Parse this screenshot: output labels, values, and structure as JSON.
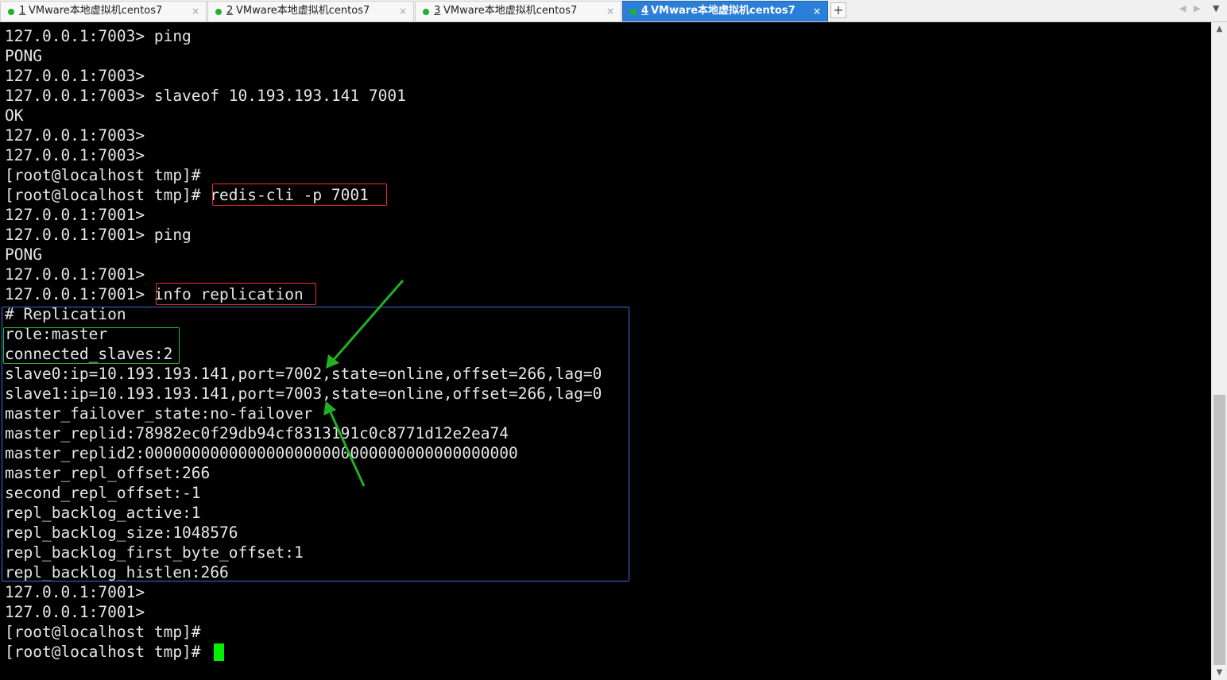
{
  "tabs": [
    {
      "number": "1",
      "label": "VMware本地虚拟机centos7",
      "status_color": "#1db32b",
      "active": false
    },
    {
      "number": "2",
      "label": "VMware本地虚拟机centos7",
      "status_color": "#1db32b",
      "active": false
    },
    {
      "number": "3",
      "label": "VMware本地虚拟机centos7",
      "status_color": "#1db32b",
      "active": false
    },
    {
      "number": "4",
      "label": "VMware本地虚拟机centos7",
      "status_color": "#1db32b",
      "active": true
    }
  ],
  "tab_close_glyph": "×",
  "add_tab_glyph": "+",
  "tab_prev_glyph": "◀",
  "tab_next_glyph": "▶",
  "terminal": {
    "lines": [
      "127.0.0.1:7003> ping",
      "PONG",
      "127.0.0.1:7003>",
      "127.0.0.1:7003> slaveof 10.193.193.141 7001",
      "OK",
      "127.0.0.1:7003>",
      "127.0.0.1:7003>",
      "[root@localhost tmp]#",
      "[root@localhost tmp]# redis-cli -p 7001",
      "127.0.0.1:7001>",
      "127.0.0.1:7001> ping",
      "PONG",
      "127.0.0.1:7001>",
      "127.0.0.1:7001> info replication",
      "# Replication",
      "role:master",
      "connected_slaves:2",
      "slave0:ip=10.193.193.141,port=7002,state=online,offset=266,lag=0",
      "slave1:ip=10.193.193.141,port=7003,state=online,offset=266,lag=0",
      "master_failover_state:no-failover",
      "master_replid:78982ec0f29db94cf8313191c0c8771d12e2ea74",
      "master_replid2:0000000000000000000000000000000000000000",
      "master_repl_offset:266",
      "second_repl_offset:-1",
      "repl_backlog_active:1",
      "repl_backlog_size:1048576",
      "repl_backlog_first_byte_offset:1",
      "repl_backlog_histlen:266",
      "127.0.0.1:7001>",
      "127.0.0.1:7001>",
      "[root@localhost tmp]#",
      "[root@localhost tmp]#"
    ],
    "text_color": "#e6e6e6",
    "background": "#000000",
    "cursor_color": "#00f000"
  },
  "annotations": {
    "red_box_color": "#ea2f2f",
    "blue_box_color": "#3b6fd6",
    "green_box_color": "#2fb43c",
    "arrow_color": "#22b022"
  },
  "scrollbar": {
    "up_glyph": "▲",
    "down_glyph": "▼"
  }
}
